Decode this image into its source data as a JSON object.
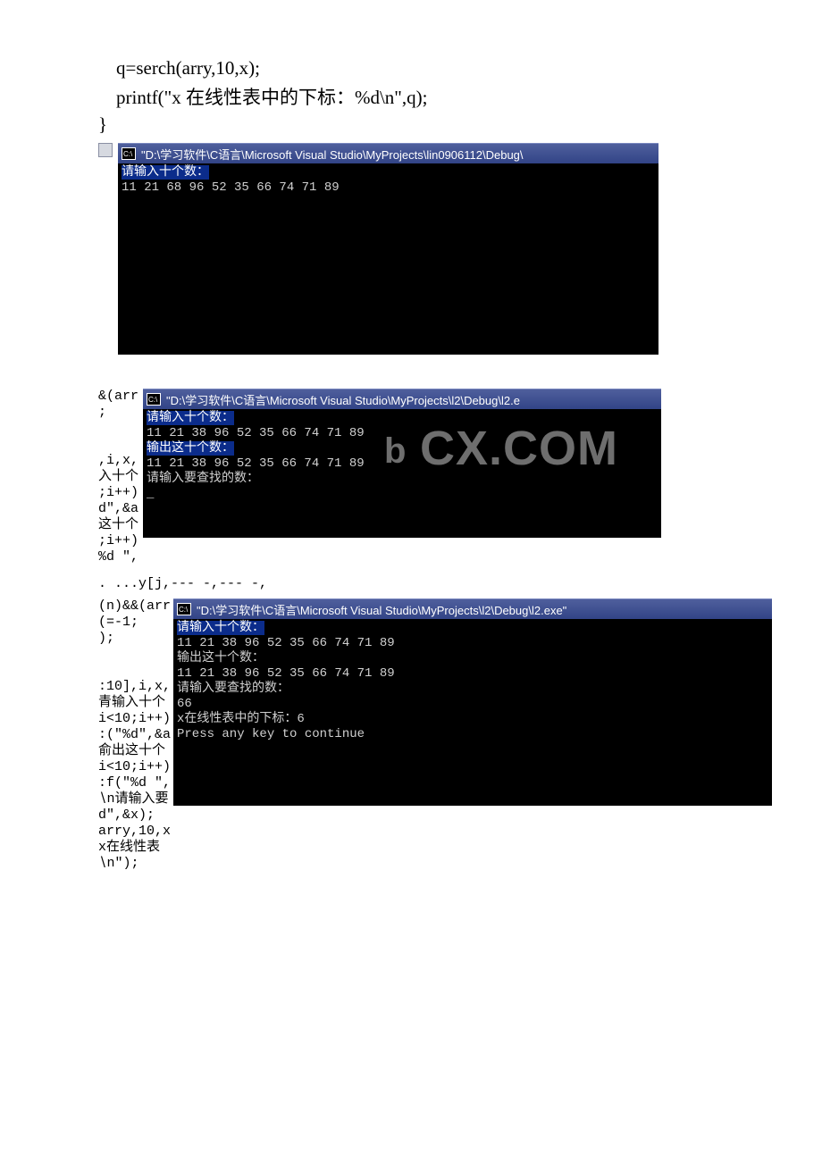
{
  "code": {
    "line1": " q=serch(arry,10,x);",
    "line2": " printf(\"x 在线性表中的下标：%d\\n\",q);",
    "line3": "}"
  },
  "watermark": "CX.COM",
  "console1": {
    "title": "\"D:\\学习软件\\C语言\\Microsoft Visual Studio\\MyProjects\\lin0906112\\Debug\\",
    "cmd": "C:\\",
    "prompt": "请输入十个数：",
    "input": "11 21 68 96 52 35 66 74 71 89"
  },
  "left2_a": "&(arr",
  "left2_b": ";",
  "left2_c": ",i,x,",
  "left2_d": "入十个",
  "left2_e": ";i++)",
  "left2_f": "d\",&a",
  "left2_g": "这十个",
  "left2_h": ";i++)",
  "left2_i": "%d \",",
  "fragment1": ". ...y[j,--- -,--- -,",
  "console2": {
    "title": "\"D:\\学习软件\\C语言\\Microsoft Visual Studio\\MyProjects\\l2\\Debug\\l2.e",
    "cmd": "C:\\",
    "l1": "请输入十个数：",
    "l2": "11 21 38 96 52 35 66 74 71 89",
    "l3": "输出这十个数：",
    "l4": "11 21 38 96 52 35 66 74 71 89",
    "l5": "请输入要查找的数：",
    "cursor": "_"
  },
  "left3_a": "(n)&&(arr",
  "left3_b": "(=-1;",
  "left3_c": ");",
  "left3_d": ":10],i,x,",
  "left3_e": "青输入十个",
  "left3_f": "i<10;i++)",
  "left3_g": ":(\"%d\",&a",
  "left3_h": "俞出这十个",
  "left3_i": "i<10;i++)",
  "left3_j": ":f(\"%d \",",
  "left3_k": "∖n请输入要",
  "left3_l": "d\",&x);",
  "left3_m": "arry,10,x",
  "left3_n": "x在线性表",
  "left3_o": "∖n\");",
  "console3": {
    "title": "\"D:\\学习软件\\C语言\\Microsoft Visual Studio\\MyProjects\\l2\\Debug\\l2.exe\"",
    "cmd": "C:\\",
    "l1": "请输入十个数：",
    "l2": "11 21 38 96 52 35 66 74 71 89",
    "l3": "输出这十个数：",
    "l4": "11 21 38 96 52 35 66 74 71 89",
    "l5": "请输入要查找的数：",
    "l6": "66",
    "l7": "x在线性表中的下标：6",
    "l8": "Press any key to continue"
  }
}
